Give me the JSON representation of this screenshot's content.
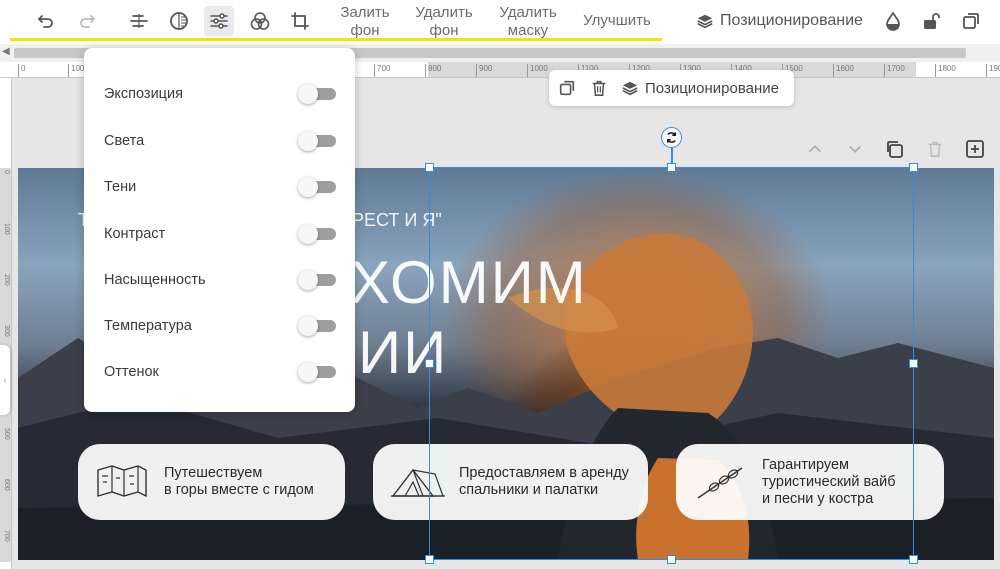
{
  "toolbar": {
    "icons": [
      "undo-icon",
      "redo-icon",
      "align-icon",
      "contrast-icon",
      "adjustments-icon",
      "filters-icon",
      "crop-icon"
    ],
    "fill_bg": "Залить\nфон",
    "fill_bg_l1": "Залить",
    "fill_bg_l2": "фон",
    "remove_bg_l1": "Удалить",
    "remove_bg_l2": "фон",
    "remove_mask_l1": "Удалить",
    "remove_mask_l2": "маску",
    "improve": "Улучшить",
    "positioning": "Позиционирование",
    "right_icons": [
      "opacity-icon",
      "unlock-icon",
      "duplicate-icon"
    ]
  },
  "ruler": {
    "h_labels": [
      "0",
      "100",
      "700",
      "800",
      "900",
      "1000",
      "1100",
      "1200",
      "1300",
      "1400",
      "1500",
      "1600",
      "1700",
      "1800",
      "190"
    ],
    "v_labels": [
      "0",
      "100",
      "200",
      "300",
      "400",
      "500",
      "600",
      "700"
    ]
  },
  "float_toolbar": {
    "positioning": "Позиционирование"
  },
  "adjustments": {
    "items": [
      {
        "label": "Экспозиция",
        "enabled": false
      },
      {
        "label": "Света",
        "enabled": false
      },
      {
        "label": "Тени",
        "enabled": false
      },
      {
        "label": "Контраст",
        "enabled": false
      },
      {
        "label": "Насыщенность",
        "enabled": false
      },
      {
        "label": "Температура",
        "enabled": false
      },
      {
        "label": "Оттенок",
        "enabled": false
      }
    ]
  },
  "banner": {
    "small_text_left": "Т",
    "small_text": "ЕРЕСТ И Я\"",
    "big_line1": "ХОМИМ",
    "big_line2": "ИИ",
    "pills": [
      {
        "line1": "Путешествуем",
        "line2": "в горы вместе с гидом",
        "icon": "map-icon"
      },
      {
        "line1": "Предоставляем в аренду",
        "line2": "спальники и палатки",
        "icon": "tent-icon"
      },
      {
        "line1": "Гарантируем",
        "line2": "туристический вайб",
        "line3": "и песни у костра",
        "icon": "skewer-icon"
      }
    ]
  },
  "colors": {
    "selection": "#2e8ee6",
    "highlight": "#f2e600"
  }
}
